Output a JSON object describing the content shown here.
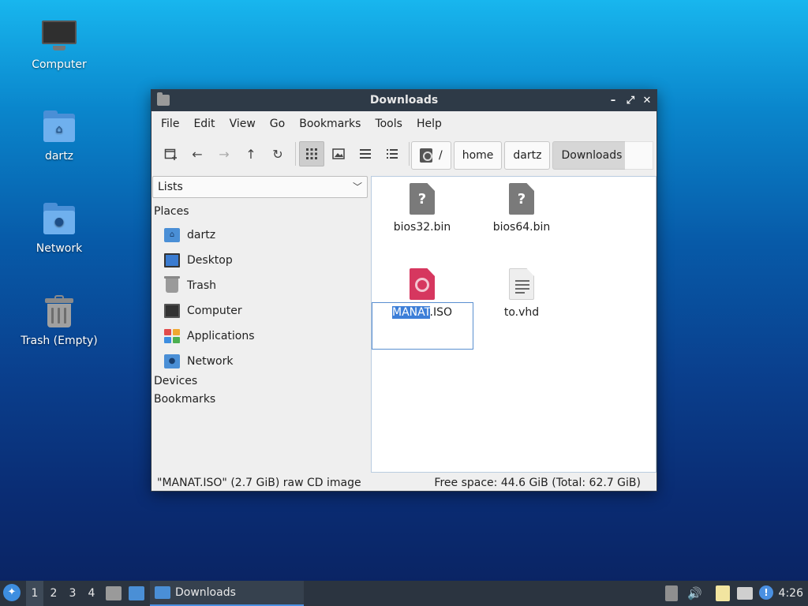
{
  "desktop": {
    "icons": [
      {
        "label": "Computer"
      },
      {
        "label": "dartz"
      },
      {
        "label": "Network"
      },
      {
        "label": "Trash (Empty)"
      }
    ]
  },
  "window": {
    "title": "Downloads",
    "controls": {
      "minimize": "–",
      "maximize": "⤢",
      "close": "✕"
    },
    "menu": [
      "File",
      "Edit",
      "View",
      "Go",
      "Bookmarks",
      "Tools",
      "Help"
    ],
    "path": [
      "/",
      "home",
      "dartz",
      "Downloads"
    ],
    "side_pane_mode": "Lists",
    "sections": {
      "places": "Places",
      "devices": "Devices",
      "bookmarks": "Bookmarks"
    },
    "places": [
      "dartz",
      "Desktop",
      "Trash",
      "Computer",
      "Applications",
      "Network"
    ],
    "files": [
      {
        "name": "bios32.bin",
        "icon": "unknown-file-icon"
      },
      {
        "name": "bios64.bin",
        "icon": "unknown-file-icon"
      },
      {
        "name_selected": "MANAT",
        "name_rest": ".ISO",
        "icon": "cd-image-icon"
      },
      {
        "name": "to.vhd",
        "icon": "text-file-icon"
      }
    ],
    "status_left": "\"MANAT.ISO\" (2.7 GiB) raw CD image",
    "status_right": "Free space: 44.6 GiB (Total: 62.7 GiB)"
  },
  "taskbar": {
    "workspaces": [
      "1",
      "2",
      "3",
      "4"
    ],
    "active_workspace": "1",
    "task_label": "Downloads",
    "clock": "4:26"
  },
  "colors": {
    "accent": "#3d7fd8",
    "titlebar": "#2e3a47",
    "taskbar": "#2b3440"
  }
}
